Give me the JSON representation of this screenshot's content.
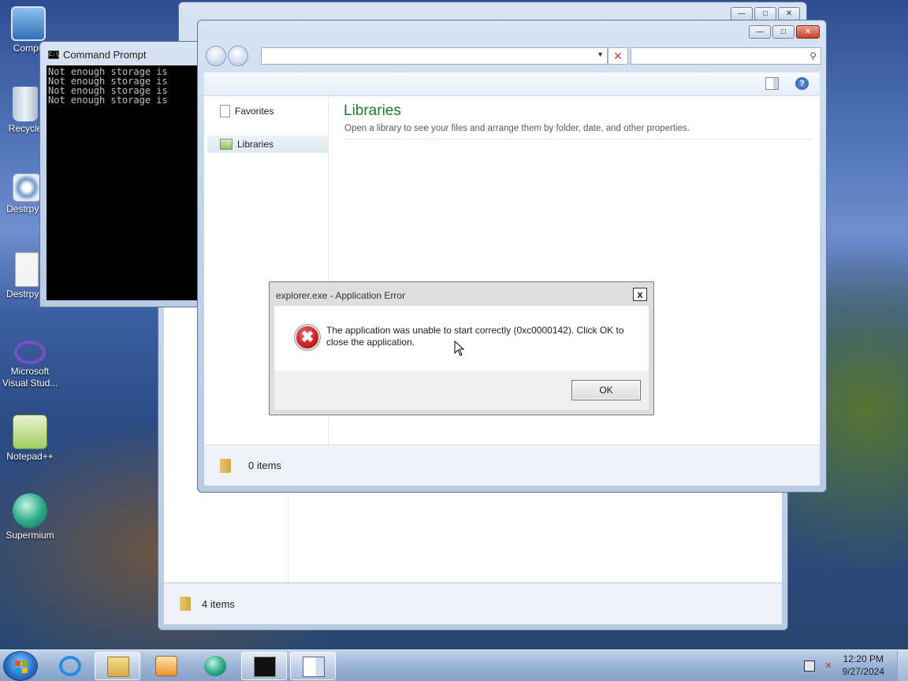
{
  "desktop": {
    "icons": [
      {
        "label": "Compu",
        "icon": "computer-icon"
      },
      {
        "label": "Recycle",
        "icon": "recycle-bin-icon"
      },
      {
        "label": "Destrpy F",
        "icon": "settings-gear-icon"
      },
      {
        "label": "Destrpy F",
        "icon": "text-file-icon"
      },
      {
        "label": "Microsoft Visual Stud...",
        "icon": "visual-studio-icon"
      },
      {
        "label": "Notepad++",
        "icon": "notepadpp-icon"
      },
      {
        "label": "Supermium",
        "icon": "supermium-icon"
      }
    ]
  },
  "cmd": {
    "title": "Command Prompt",
    "icon_text": "C:\\",
    "lines": [
      "Not enough storage is",
      "Not enough storage is",
      "Not enough storage is",
      "Not enough storage is"
    ]
  },
  "back_window": {
    "status_count": "4 items"
  },
  "library_window": {
    "address_value": "",
    "search_placeholder": "",
    "nav": {
      "favorites": "Favorites",
      "libraries": "Libraries"
    },
    "heading": "Libraries",
    "description": "Open a library to see your files and arrange them by folder, date, and other properties.",
    "status_count": "0 items"
  },
  "dialog": {
    "title": "explorer.exe - Application Error",
    "message": "The application was unable to start correctly (0xc0000142). Click OK to close the application.",
    "ok_label": "OK",
    "close_label": "x"
  },
  "taskbar": {
    "time": "12:20 PM",
    "date": "9/27/2024",
    "apps": [
      "internet-explorer-icon",
      "file-explorer-icon",
      "media-player-icon",
      "supermium-icon",
      "command-prompt-icon",
      "window-app-icon"
    ]
  },
  "colors": {
    "accent_heading": "#1e7a2d",
    "error_red": "#c81e1e",
    "close_red": "#c8432a"
  }
}
